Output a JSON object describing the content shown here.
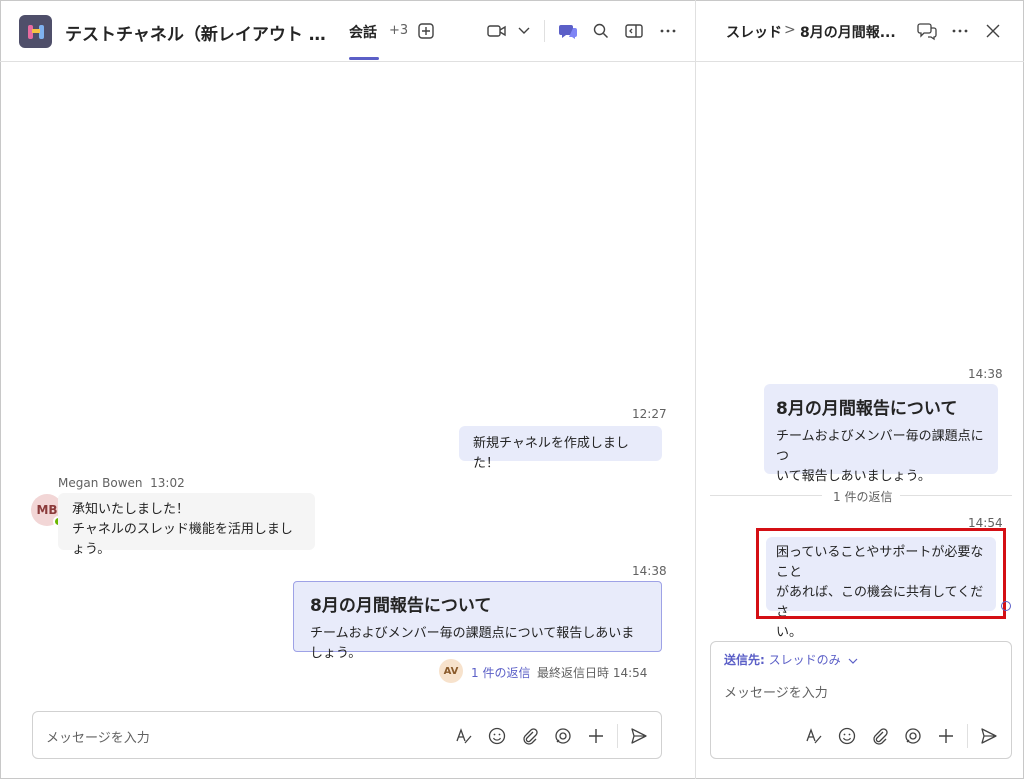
{
  "header": {
    "channel_title": "テストチャネル（新レイアウト - ス...",
    "tab_label": "会話",
    "tab_more": "+3"
  },
  "messages": {
    "m1": {
      "time": "12:27",
      "text": "新規チャネルを作成しました！"
    },
    "m2": {
      "author": "Megan Bowen",
      "time": "13:02",
      "initials": "MB",
      "line1": "承知いたしました！",
      "line2": "チャネルのスレッド機能を活用しましょう。"
    },
    "post": {
      "time": "14:38",
      "title": "8月の月間報告について",
      "body": "チームおよびメンバー毎の課題点について報告しあいましょう。",
      "reply_avatar": "AV",
      "reply_link": "1 件の返信",
      "last_reply": "最終返信日時 14:54"
    }
  },
  "compose": {
    "placeholder": "メッセージを入力"
  },
  "thread": {
    "label": "スレッド",
    "chevron": ">",
    "title": "8月の月間報...",
    "post_time": "14:38",
    "post_title": "8月の月間報告について",
    "post_body_1": "チームおよびメンバー毎の課題点につ",
    "post_body_2": "いて報告しあいましょう。",
    "reply_count": "1 件の返信",
    "reply_time": "14:54",
    "reply_1": "困っていることやサポートが必要なこと",
    "reply_2": "があれば、この機会に共有してくださ",
    "reply_3": "い。",
    "send_to_label": "送信先:",
    "send_to_value": "スレッドのみ",
    "placeholder": "メッセージを入力"
  },
  "colors": {
    "accent": "#5b5fc7",
    "highlight": "#d40f14",
    "bubble": "#e8ebfa"
  }
}
